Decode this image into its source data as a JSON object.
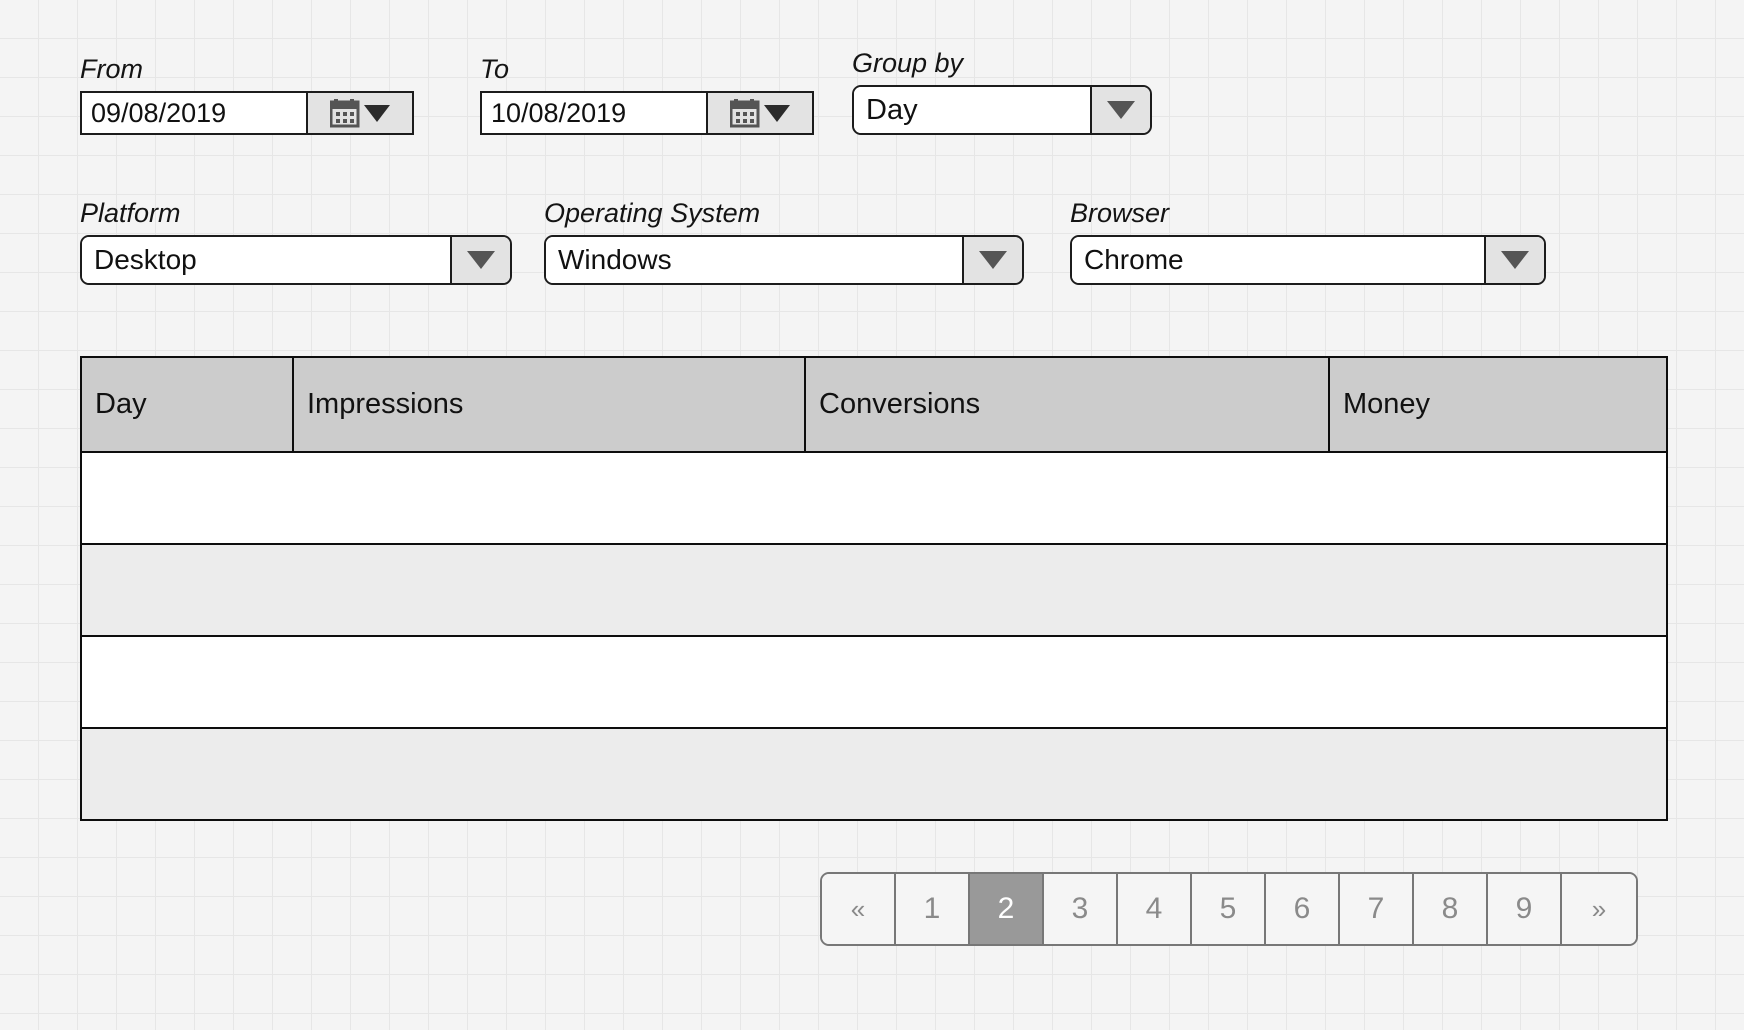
{
  "filters": {
    "from": {
      "label": "From",
      "value": "09/08/2019",
      "icon": "calendar-icon"
    },
    "to": {
      "label": "To",
      "value": "10/08/2019",
      "icon": "calendar-icon"
    },
    "group_by": {
      "label": "Group by",
      "value": "Day",
      "icon": "chevron-down-icon"
    },
    "platform": {
      "label": "Platform",
      "value": "Desktop",
      "icon": "chevron-down-icon"
    },
    "operating_system": {
      "label": "Operating System",
      "value": "Windows",
      "icon": "chevron-down-icon"
    },
    "browser": {
      "label": "Browser",
      "value": "Chrome",
      "icon": "chevron-down-icon"
    }
  },
  "table": {
    "columns": [
      "Day",
      "Impressions",
      "Conversions",
      "Money"
    ],
    "rows": [
      [
        "",
        "",
        "",
        ""
      ],
      [
        "",
        "",
        "",
        ""
      ],
      [
        "",
        "",
        "",
        ""
      ],
      [
        "",
        "",
        "",
        ""
      ]
    ]
  },
  "pagination": {
    "prev_label": "«",
    "next_label": "»",
    "pages": [
      "1",
      "2",
      "3",
      "4",
      "5",
      "6",
      "7",
      "8",
      "9"
    ],
    "active_page": "2"
  },
  "colors": {
    "background": "#f4f4f4",
    "grid_line": "#e6e6e6",
    "border": "#0d0d0d",
    "header_fill": "#cccccc",
    "row_alt_fill": "#ececec",
    "pagination_border": "#777777",
    "pagination_active_fill": "#999999",
    "pagination_text": "#8a8a8a",
    "control_button_fill": "#e3e3e3"
  }
}
